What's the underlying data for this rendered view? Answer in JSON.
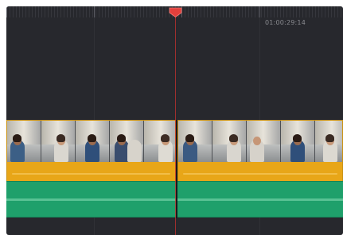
{
  "timeline": {
    "timecode": "01:00:29:14",
    "playhead_icon": "playhead-marker-icon",
    "colors": {
      "background": "#27282d",
      "video_clip": "#e8a618",
      "audio_clip": "#1fa06b",
      "playhead": "#e2403c"
    },
    "video_track": {
      "clips": [
        {
          "name": "video-clip-left"
        },
        {
          "name": "video-clip-right"
        }
      ]
    },
    "audio_track": {
      "clips": [
        {
          "name": "audio-clip-left"
        },
        {
          "name": "audio-clip-right"
        }
      ]
    }
  }
}
